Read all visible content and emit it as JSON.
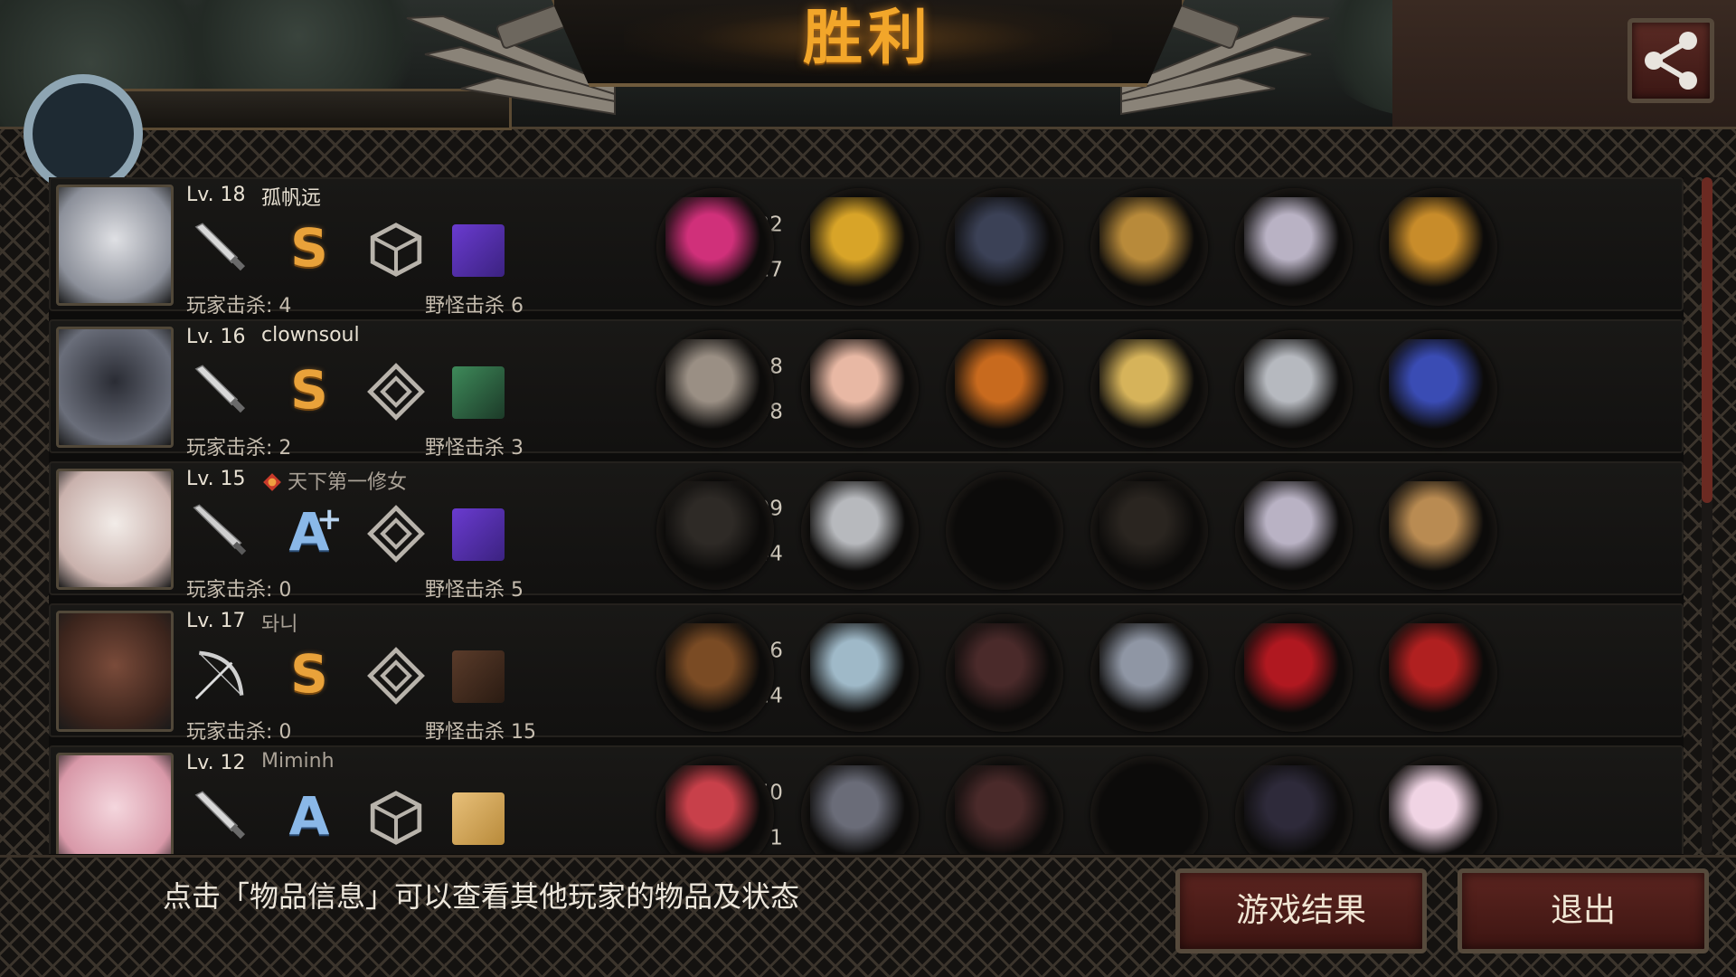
{
  "header": {
    "title": "胜利"
  },
  "players": [
    {
      "level": "Lv. 18",
      "name": "孤帆远",
      "grade": "S",
      "grade_sup": "",
      "player_kills": "玩家击杀: 4",
      "monster_kills": "野怪击杀 6",
      "attack": "222",
      "defense": "317",
      "weapon": "dagger-icon",
      "badge": "cube-emblem-icon",
      "pet": "purple-creature-icon",
      "items": [
        "pink-crystal-blade-icon",
        "royal-crown-icon",
        "dark-plate-armor-icon",
        "golden-vine-ring-icon",
        "white-boots-icon",
        "sapphire-earrings-icon"
      ]
    },
    {
      "level": "Lv. 16",
      "name": "clownsoul",
      "grade": "S",
      "grade_sup": "",
      "player_kills": "玩家击杀: 2",
      "monster_kills": "野怪击杀 3",
      "attack": "218",
      "defense": "258",
      "weapon": "dagger-icon",
      "badge": "diamond-emblem-icon",
      "pet": "green-soldier-icon",
      "items": [
        "halberd-spear-icon",
        "winged-tiara-icon",
        "flaming-armor-icon",
        "golden-shield-icon",
        "steel-greaves-icon",
        "galaxy-orb-icon"
      ]
    },
    {
      "level": "Lv. 15",
      "name": "天下第一修女",
      "grade": "A",
      "grade_sup": "+",
      "player_kills": "玩家击杀: 0",
      "monster_kills": "野怪击杀 5",
      "attack": "109",
      "defense": "144",
      "weapon": "knife-icon",
      "badge": "diamond-emblem-icon",
      "pet": "purple-creature-icon",
      "items": [
        "black-umbrella-icon",
        "knight-helmet-icon",
        "empty-slot",
        "dark-gauntlet-icon",
        "white-boots-icon",
        "cat-crate-icon"
      ]
    },
    {
      "level": "Lv. 17",
      "name": "돠니",
      "grade": "S",
      "grade_sup": "",
      "player_kills": "玩家击杀: 0",
      "monster_kills": "野怪击杀 15",
      "attack": "216",
      "defense": "224",
      "weapon": "bow-icon",
      "badge": "diamond-emblem-icon",
      "pet": "crossed-arrows-icon",
      "items": [
        "crossbow-icon",
        "silver-helmet-icon",
        "leather-coat-icon",
        "spiked-gauntlet-icon",
        "red-heels-icon",
        "quiver-icon"
      ]
    },
    {
      "level": "Lv. 12",
      "name": "Miminh",
      "grade": "A",
      "grade_sup": "",
      "player_kills": "",
      "monster_kills": "",
      "attack": "150",
      "defense": "171",
      "weapon": "dagger-icon",
      "badge": "cube-emblem-icon",
      "pet": "bread-icon",
      "items": [
        "crimson-saber-icon",
        "dark-tiara-icon",
        "leather-coat-icon",
        "empty-slot",
        "dark-boots-icon",
        "pearl-icon"
      ]
    }
  ],
  "footer": {
    "hint": "点击「物品信息」可以查看其他玩家的物品及状态",
    "result_button": "游戏结果",
    "exit_button": "退出"
  },
  "colors": {
    "title": "#f2a62a",
    "button_bg": "#5b241f",
    "grade_s": "#e9a23a",
    "grade_a": "#8ab8e8"
  }
}
